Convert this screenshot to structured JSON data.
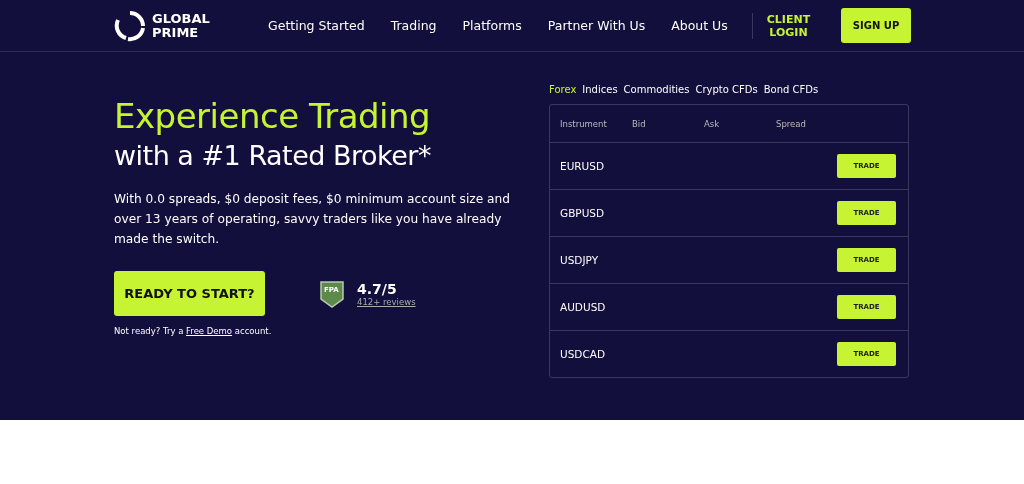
{
  "brand": {
    "name_line_1": "GLOBAL",
    "name_line_2": "PRIME"
  },
  "nav": [
    "Getting Started",
    "Trading",
    "Platforms",
    "Partner With Us",
    "About Us"
  ],
  "client_login": {
    "line_1": "CLIENT",
    "line_2": "LOGIN"
  },
  "signup": "SIGN UP",
  "hero": {
    "headline": "Experience Trading",
    "subheadline": "with a #1 Rated Broker*",
    "body": "With 0.0 spreads, $0 deposit fees, $0 minimum account size and over 13 years of operating, savvy traders like you have already made the switch.",
    "cta": "READY TO START?",
    "note_before": "Not ready? Try a",
    "note_link": "Free Demo",
    "note_after": "account."
  },
  "rating": {
    "badge": "FPA",
    "score": "4.7/5",
    "reviews": "412+ reviews"
  },
  "tabs": [
    {
      "label": "Forex",
      "selected": true
    },
    {
      "label": "Indices",
      "selected": false
    },
    {
      "label": "Commodities",
      "selected": false
    },
    {
      "label": "Crypto CFDs",
      "selected": false
    },
    {
      "label": "Bond CFDs",
      "selected": false
    }
  ],
  "table": {
    "columns": [
      "Instrument",
      "Bid",
      "Ask",
      "Spread"
    ],
    "rows": [
      {
        "instrument": "EURUSD",
        "action": "TRADE"
      },
      {
        "instrument": "GBPUSD",
        "action": "TRADE"
      },
      {
        "instrument": "USDJPY",
        "action": "TRADE"
      },
      {
        "instrument": "AUDUSD",
        "action": "TRADE"
      },
      {
        "instrument": "USDCAD",
        "action": "TRADE"
      }
    ]
  }
}
